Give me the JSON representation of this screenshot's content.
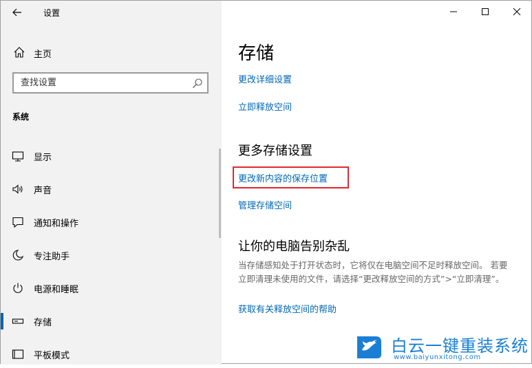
{
  "window": {
    "title": "设置"
  },
  "sidebar": {
    "home_label": "主页",
    "search_placeholder": "查找设置",
    "section_label": "系统",
    "items": [
      {
        "label": "显示",
        "icon": "monitor-icon"
      },
      {
        "label": "声音",
        "icon": "speaker-icon"
      },
      {
        "label": "通知和操作",
        "icon": "notification-icon"
      },
      {
        "label": "专注助手",
        "icon": "moon-icon"
      },
      {
        "label": "电源和睡眠",
        "icon": "power-icon"
      },
      {
        "label": "存储",
        "icon": "storage-icon",
        "selected": true
      },
      {
        "label": "平板模式",
        "icon": "tablet-icon"
      }
    ]
  },
  "main": {
    "title": "存储",
    "links_top": [
      "更改详细设置",
      "立即释放空间"
    ],
    "more_heading": "更多存储设置",
    "more_links": [
      "更改新内容的保存位置",
      "管理存储空间"
    ],
    "declutter_heading": "让你的电脑告别杂乱",
    "declutter_desc": "当存储感知处于打开状态时，它将仅在电脑空间不足时释放空间。 若要立即清理未使用的文件，请选择“更改释放空间的方式”>“立即清理”。",
    "help_link": "获取有关释放空间的帮助"
  },
  "watermark": {
    "text": "白云一键重装系统",
    "url": "www.baiyunxitong.com"
  },
  "colors": {
    "accent": "#0063b1",
    "link": "#0067b8",
    "highlight": "#e0282e",
    "sidebar_bg": "#f2f2f2"
  }
}
